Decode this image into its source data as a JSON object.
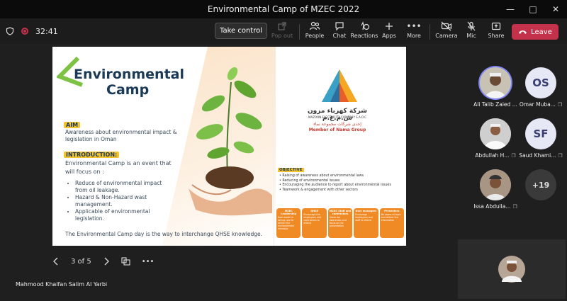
{
  "window": {
    "title": "Environmental Camp of MZEC 2022"
  },
  "toolbar": {
    "timer": "32:41",
    "take_control": "Take control",
    "pop_out": "Pop out",
    "people": "People",
    "chat": "Chat",
    "reactions": "Reactions",
    "apps": "Apps",
    "more": "More",
    "camera": "Camera",
    "mic": "Mic",
    "share": "Share",
    "leave": "Leave"
  },
  "slide": {
    "title_line1": "Environmental",
    "title_line2": "Camp",
    "aim_label": "AIM",
    "aim_text": "Awareness about environmental impact & legislation in Oman",
    "intro_label": "INTRODUCTION:",
    "intro_text": "Environmental Camp is an event that will focus on :",
    "bullets": [
      "Reduce of environmental impact from oil leakage.",
      "Hazard & Non-Hazard wast management.",
      "Applicable of environmental legislation."
    ],
    "footer": "The Environmental Camp day is the way to interchange QHSE knowledge.",
    "company_ar": "شركة كهرباء مزون ش.م.ع.م",
    "company_en": "MAZOON ELECTRICITY COMPANY S.A.O.C",
    "nama_ar": "إحدى شركات مجموعة نماء",
    "nama_en": "Member of Nama Group",
    "objective_label": "OBJECTIVE",
    "objectives": [
      "Raising of awareness about environmental laws",
      "Reducing of environmental issues",
      "Encouraging the audience to report about environmental issues",
      "Teamwork & engagement with other sectors"
    ],
    "cards": [
      {
        "title": "MZEC Leadership",
        "text": "Role model in taking care to deliver the environmental message"
      },
      {
        "title": "QHSE",
        "text": "Encourage the employees and contractors to attend"
      },
      {
        "title": "MZEC Staff and contractors",
        "text": "Share the awareness and focus on the presentation"
      },
      {
        "title": "User managers",
        "text": "Encourage employees and staff to attend"
      },
      {
        "title": "Presenters",
        "text": "Be aware of topic and deliver the information"
      }
    ]
  },
  "slide_nav": {
    "counter": "3 of 5"
  },
  "presenter_name": "Mahmood Khalfan Salim Al Yarbi",
  "participants": [
    {
      "name": "Ali Talib Zaied ...",
      "initials": "",
      "photo": true,
      "speaking": true,
      "muted": false
    },
    {
      "name": "Omar Muba...",
      "initials": "OS",
      "photo": false,
      "speaking": false,
      "muted": true
    },
    {
      "name": "Abdullah H...",
      "initials": "",
      "photo": true,
      "speaking": false,
      "muted": true
    },
    {
      "name": "Saud Khami...",
      "initials": "SF",
      "photo": false,
      "speaking": false,
      "muted": true
    },
    {
      "name": "Issa Abdulla...",
      "initials": "",
      "photo": true,
      "speaking": false,
      "muted": true
    }
  ],
  "more_participants": "+19"
}
